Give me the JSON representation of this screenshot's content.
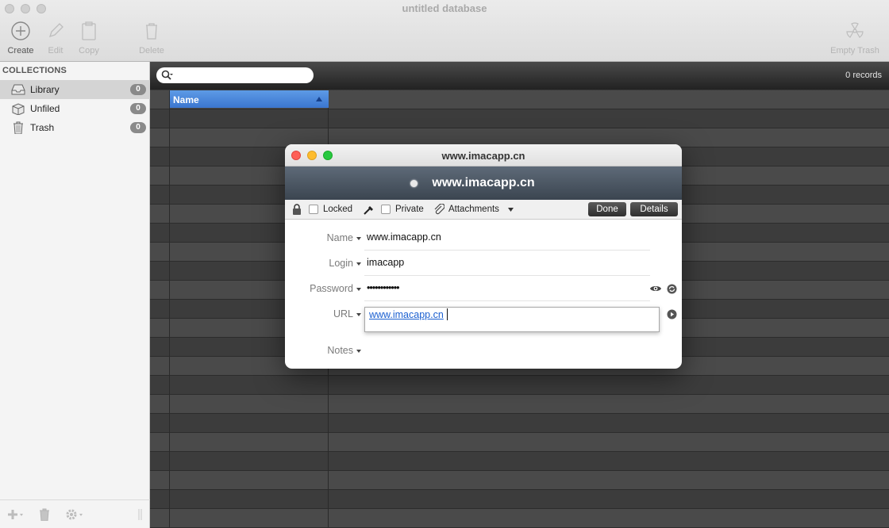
{
  "window": {
    "title": "untitled database"
  },
  "toolbar": {
    "create": "Create",
    "edit": "Edit",
    "copy": "Copy",
    "delete": "Delete",
    "empty_trash": "Empty Trash"
  },
  "sidebar": {
    "heading": "COLLECTIONS",
    "items": [
      {
        "label": "Library",
        "count": "0",
        "icon": "inbox-icon"
      },
      {
        "label": "Unfiled",
        "count": "0",
        "icon": "box-icon"
      },
      {
        "label": "Trash",
        "count": "0",
        "icon": "trash-icon"
      }
    ]
  },
  "list": {
    "records": "0 records",
    "column_name": "Name"
  },
  "dialog": {
    "title": "www.imacapp.cn",
    "header_title": "www.imacapp.cn",
    "locked_label": "Locked",
    "private_label": "Private",
    "attachments_label": "Attachments",
    "done_label": "Done",
    "details_label": "Details",
    "fields": {
      "name_label": "Name",
      "name_value": "www.imacapp.cn",
      "login_label": "Login",
      "login_value": "imacapp",
      "password_label": "Password",
      "password_value": "••••••••••••",
      "url_label": "URL",
      "url_value": "www.imacapp.cn",
      "notes_label": "Notes"
    }
  },
  "colors": {
    "accent": "#3b76cf",
    "close": "#fe5f57",
    "minimize": "#febc2e",
    "zoom": "#28c840"
  }
}
